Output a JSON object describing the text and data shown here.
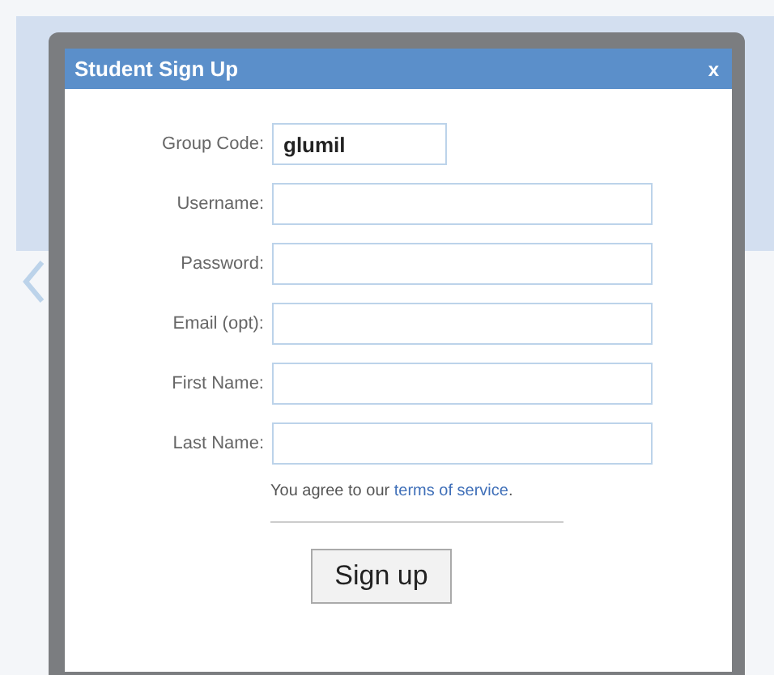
{
  "dialog": {
    "title": "Student Sign Up",
    "close": "x"
  },
  "fields": [
    {
      "label": "Group Code:",
      "value": "glumil",
      "kind": "short"
    },
    {
      "label": "Username:",
      "kind": "long"
    },
    {
      "label": "Password:",
      "kind": "long"
    },
    {
      "label": "Email (opt):",
      "kind": "long"
    },
    {
      "label": "First Name:",
      "kind": "long"
    },
    {
      "label": "Last Name:",
      "kind": "long"
    }
  ],
  "agreement": {
    "text": "You agree to our",
    "link": "terms of service",
    "end": "."
  },
  "submit": "Sign up"
}
